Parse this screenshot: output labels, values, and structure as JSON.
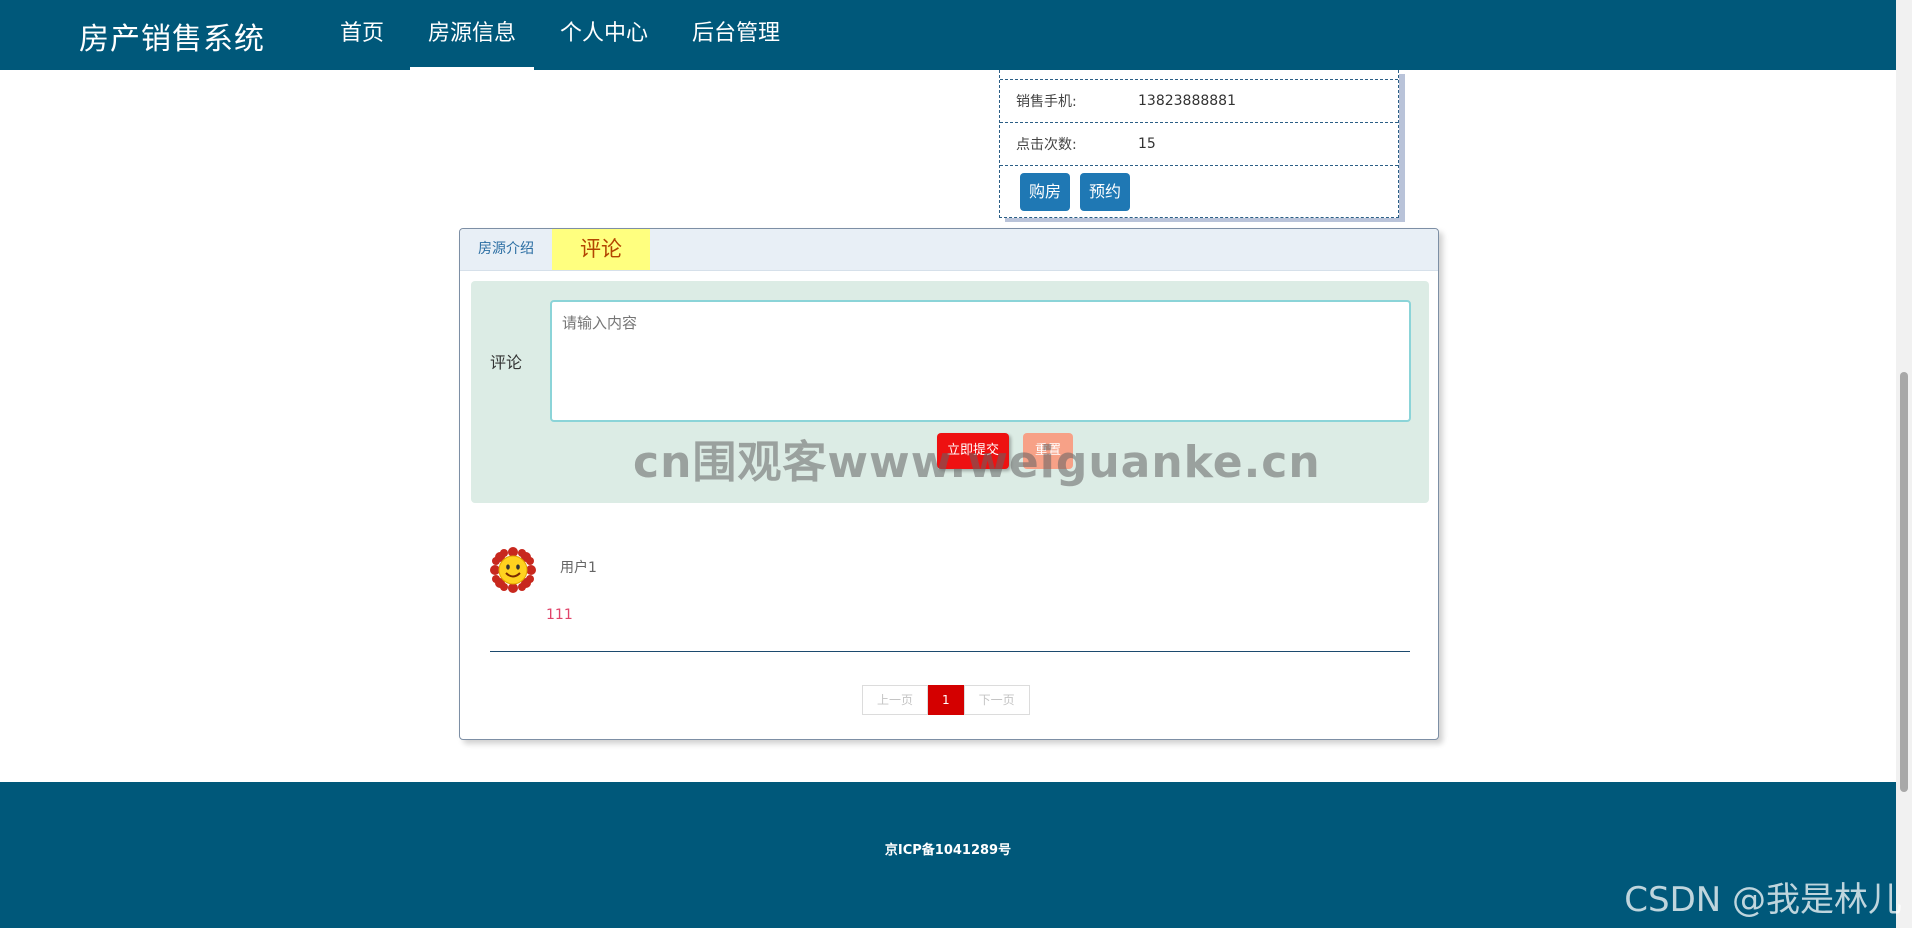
{
  "header": {
    "brand": "房产销售系统",
    "nav": [
      {
        "label": "首页"
      },
      {
        "label": "房源信息"
      },
      {
        "label": "个人中心"
      },
      {
        "label": "后台管理"
      }
    ],
    "active_nav": "房源信息"
  },
  "info_card": {
    "rows": [
      {
        "label": "销售手机:",
        "value": "13823888881"
      },
      {
        "label": "点击次数:",
        "value": "15"
      }
    ],
    "buy_label": "购房",
    "reserve_label": "预约"
  },
  "tabs": [
    {
      "label": "房源介绍"
    },
    {
      "label": "评论"
    }
  ],
  "active_tab": "评论",
  "comment_form": {
    "label": "评论",
    "placeholder": "请输入内容",
    "submit_label": "立即提交",
    "reset_label": "重置"
  },
  "watermark": "cn围观客www.weiguanke.cn",
  "comments": [
    {
      "user": "用户1",
      "text": "111",
      "avatar_icon": "sunflower-smiley-icon"
    }
  ],
  "pagination": {
    "prev_label": "上一页",
    "current": "1",
    "next_label": "下一页"
  },
  "footer": {
    "icp": "京ICP备1041289号"
  },
  "overlay_watermark": "CSDN @我是林儿",
  "colors": {
    "nav_bg": "#00587a",
    "primary_button": "#1f78b4",
    "submit_button": "#ee1111",
    "reset_button": "#f7a187",
    "active_tab_bg": "#ffff7f",
    "pager_current": "#d40000"
  }
}
